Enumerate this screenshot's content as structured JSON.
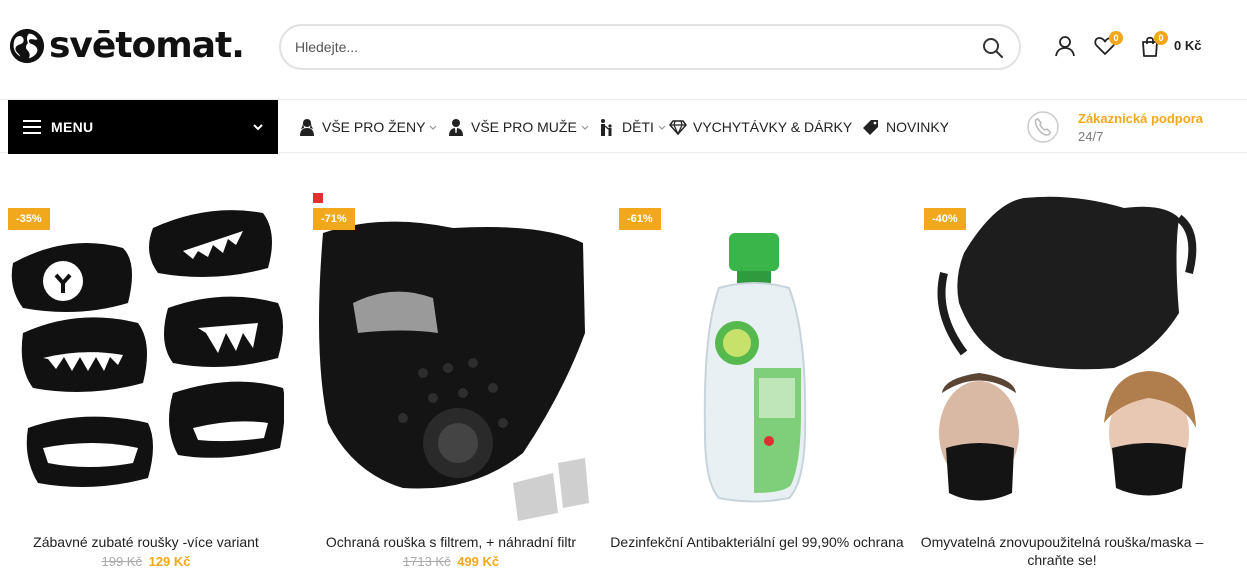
{
  "brand": {
    "name": "svētomat."
  },
  "search": {
    "placeholder": "Hledejte..."
  },
  "header": {
    "wishlist_count": "0",
    "cart_count": "0",
    "cart_total": "0 Kč"
  },
  "nav": {
    "menu_label": "MENU",
    "items": [
      {
        "label": "VŠE PRO ŽENY",
        "icon": "woman-icon"
      },
      {
        "label": "VŠE PRO MUŽE",
        "icon": "man-icon"
      },
      {
        "label": "DĚTI",
        "icon": "family-icon"
      },
      {
        "label": "VYCHYTÁVKY & DÁRKY",
        "icon": "diamond-icon"
      },
      {
        "label": "NOVINKY",
        "icon": "tag-icon"
      }
    ],
    "support_title": "Zákaznická podpora",
    "support_hours": "24/7"
  },
  "products": [
    {
      "sale": "-35%",
      "title": "Zábavné zubaté roušky -více variant",
      "old_price": "199 Kč",
      "new_price": "129 Kč"
    },
    {
      "sale": "-71%",
      "title": "Ochraná rouška s filtrem, + náhradní filtr",
      "old_price": "1713 Kč",
      "new_price": "499 Kč"
    },
    {
      "sale": "-61%",
      "title": "Dezinfekční Antibakteriální gel 99,90% ochrana",
      "old_price": "",
      "new_price": ""
    },
    {
      "sale": "-40%",
      "title": "Omyvatelná znovupoužitelná rouška/maska – chraňte se!",
      "old_price": "",
      "new_price": ""
    }
  ],
  "colors": {
    "accent": "#f2a81d",
    "menu_bg": "#000000"
  }
}
